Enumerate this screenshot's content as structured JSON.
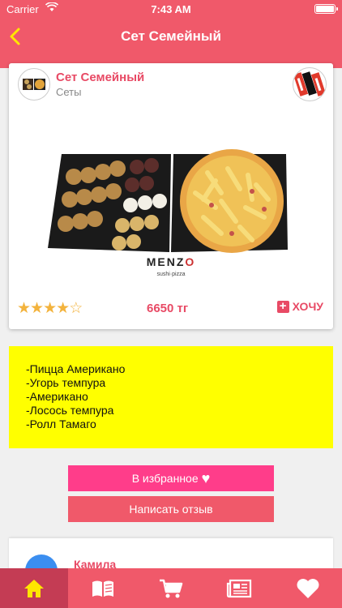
{
  "status_bar": {
    "carrier": "Carrier",
    "time": "7:43 AM"
  },
  "nav": {
    "title": "Сет Семейный",
    "back_icon": "chevron-left-icon"
  },
  "product": {
    "name": "Сет Семейный",
    "category": "Сеты",
    "photo_brand": "MENZO",
    "photo_tagline": "sushi·pizza",
    "rating": 4,
    "rating_max": 5,
    "price": "6650 тг",
    "want_label": "ХОЧУ"
  },
  "ingredients": [
    "-Пицца Американо",
    "-Угорь темпура",
    "-Американо",
    "-Лосось темпура",
    "-Ролл Тамаго"
  ],
  "actions": {
    "favorite_label": "В избранное",
    "review_label": "Написать отзыв"
  },
  "review": {
    "author": "Камила"
  },
  "tabbar": {
    "items": [
      {
        "icon": "home-icon",
        "active": true
      },
      {
        "icon": "menu-book-icon",
        "active": false
      },
      {
        "icon": "cart-icon",
        "active": false
      },
      {
        "icon": "news-icon",
        "active": false
      },
      {
        "icon": "heart-icon",
        "active": false
      }
    ]
  },
  "colors": {
    "brand": "#f0596a",
    "accent_text": "#e84a65",
    "favorite_button": "#ff3d8a",
    "ingredients_bg": "#ffff00",
    "stars": "#f3b33d"
  }
}
